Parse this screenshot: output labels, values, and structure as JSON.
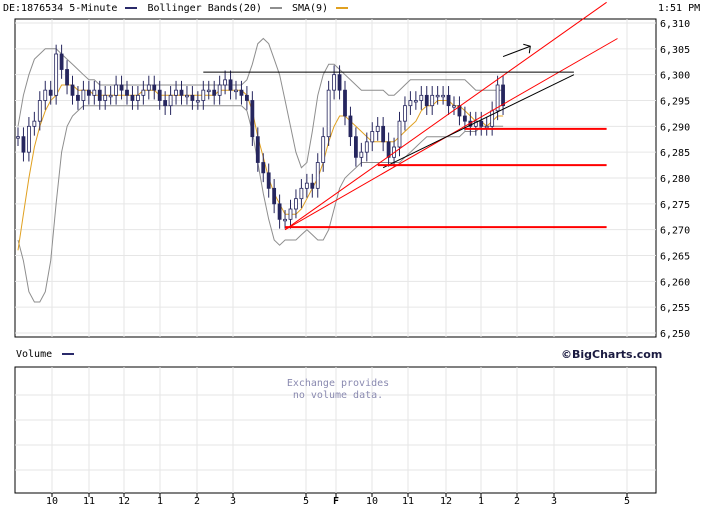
{
  "header": {
    "symbol": "DE:1876534",
    "interval": "5-Minute",
    "time": "1:51 PM",
    "legend": [
      {
        "label": "Bollinger Bands(20)",
        "color": "#8e8e8e",
        "icon": "gray-line-swatch"
      },
      {
        "label": "SMA(9)",
        "color": "#e0a020",
        "icon": "orange-line-swatch"
      }
    ],
    "symbol_swatch_color": "#2a2a6a"
  },
  "volume_panel": {
    "label": "Volume",
    "swatch_color": "#2a2a6a",
    "brand": "©BigCharts.com",
    "message_line1": "Exchange provides",
    "message_line2": "no volume data."
  },
  "colors": {
    "grid": "#e6e6e6",
    "price": "#26265e",
    "band": "#8e8e8e",
    "sma": "#e0a020",
    "support": "#ff0000",
    "resistance": "#000000",
    "message": "#8a8ab0"
  },
  "chart_data": {
    "type": "candlestick",
    "title": "DE:1876534 5-Minute",
    "ylim": [
      6250,
      6310
    ],
    "y_ticks": [
      "6,250",
      "6,255",
      "6,260",
      "6,265",
      "6,270",
      "6,275",
      "6,280",
      "6,285",
      "6,290",
      "6,295",
      "6,300",
      "6,305",
      "6,310"
    ],
    "x_ticks": [
      "10",
      "11",
      "12",
      "1",
      "2",
      "3",
      "5",
      "F",
      "10",
      "11",
      "12",
      "1",
      "2",
      "3",
      "5"
    ],
    "grid": true,
    "series": [
      {
        "name": "Price",
        "values": [
          6288,
          6285,
          6290,
          6291,
          6295,
          6297,
          6296,
          6304,
          6301,
          6298,
          6296,
          6295,
          6297,
          6296,
          6297,
          6295,
          6296,
          6296,
          6298,
          6297,
          6296,
          6295,
          6296,
          6297,
          6298,
          6297,
          6295,
          6294,
          6296,
          6297,
          6296,
          6296,
          6295,
          6295,
          6297,
          6297,
          6296,
          6298,
          6299,
          6297,
          6297,
          6296,
          6295,
          6288,
          6283,
          6281,
          6278,
          6275,
          6272,
          6272,
          6274,
          6276,
          6278,
          6279,
          6278,
          6283,
          6288,
          6297,
          6300,
          6297,
          6292,
          6288,
          6284,
          6285,
          6287,
          6289,
          6290,
          6287,
          6284,
          6286,
          6291,
          6294,
          6295,
          6295,
          6296,
          6294,
          6296,
          6296,
          6296,
          6294,
          6294,
          6292,
          6291,
          6290,
          6291,
          6290,
          6290,
          6293,
          6298,
          6294
        ]
      },
      {
        "name": "Bollinger Bands(20) upper",
        "values": [
          6290,
          6296,
          6300,
          6303,
          6304,
          6305,
          6305,
          6305,
          6304,
          6303,
          6302,
          6301,
          6300,
          6299,
          6299,
          6298,
          6298,
          6298,
          6298,
          6298,
          6298,
          6298,
          6298,
          6298,
          6298,
          6298,
          6298,
          6298,
          6298,
          6298,
          6298,
          6298,
          6298,
          6298,
          6298,
          6298,
          6298,
          6298,
          6298,
          6298,
          6298,
          6298,
          6299,
          6302,
          6306,
          6307,
          6306,
          6303,
          6300,
          6295,
          6290,
          6285,
          6282,
          6283,
          6289,
          6296,
          6300,
          6302,
          6302,
          6301,
          6300,
          6299,
          6298,
          6297,
          6297,
          6297,
          6297,
          6297,
          6296,
          6296,
          6297,
          6298,
          6299,
          6299,
          6299,
          6299,
          6299,
          6299,
          6299,
          6299,
          6299,
          6299,
          6299,
          6298,
          6297,
          6297,
          6297,
          6297,
          6297,
          6297
        ]
      },
      {
        "name": "Bollinger Bands(20) lower",
        "values": [
          6268,
          6264,
          6258,
          6256,
          6256,
          6258,
          6264,
          6275,
          6285,
          6290,
          6292,
          6293,
          6294,
          6294,
          6294,
          6294,
          6294,
          6294,
          6294,
          6294,
          6294,
          6294,
          6294,
          6294,
          6294,
          6294,
          6294,
          6294,
          6294,
          6294,
          6294,
          6294,
          6294,
          6294,
          6294,
          6294,
          6294,
          6294,
          6294,
          6294,
          6294,
          6294,
          6293,
          6289,
          6283,
          6277,
          6272,
          6268,
          6267,
          6268,
          6268,
          6268,
          6269,
          6270,
          6269,
          6268,
          6268,
          6270,
          6274,
          6278,
          6280,
          6281,
          6282,
          6283,
          6283,
          6283,
          6283,
          6283,
          6283,
          6283,
          6283,
          6284,
          6285,
          6286,
          6287,
          6288,
          6288,
          6288,
          6288,
          6288,
          6288,
          6288,
          6289,
          6289,
          6289,
          6290,
          6290,
          6290,
          6290,
          6290
        ]
      },
      {
        "name": "SMA(9)",
        "values": [
          6266,
          6273,
          6280,
          6286,
          6290,
          6293,
          6295,
          6296,
          6298,
          6298,
          6298,
          6297,
          6297,
          6297,
          6296,
          6296,
          6296,
          6296,
          6296,
          6296,
          6296,
          6296,
          6296,
          6297,
          6297,
          6297,
          6296,
          6296,
          6296,
          6296,
          6296,
          6296,
          6296,
          6296,
          6296,
          6296,
          6296,
          6297,
          6297,
          6297,
          6297,
          6297,
          6296,
          6293,
          6288,
          6284,
          6280,
          6277,
          6275,
          6273,
          6273,
          6273,
          6274,
          6276,
          6278,
          6280,
          6283,
          6287,
          6290,
          6292,
          6292,
          6291,
          6290,
          6289,
          6288,
          6287,
          6287,
          6287,
          6287,
          6287,
          6288,
          6289,
          6290,
          6291,
          6293,
          6294,
          6294,
          6295,
          6295,
          6295,
          6294,
          6294,
          6293,
          6292,
          6291,
          6291,
          6290,
          6291,
          6292,
          6292
        ]
      }
    ],
    "annotations": {
      "red_horizontal": [
        {
          "value": 6289.5,
          "from_bar": 82,
          "to_bar": 108
        },
        {
          "value": 6282.5,
          "from_bar": 66,
          "to_bar": 108
        },
        {
          "value": 6270.5,
          "from_bar": 49,
          "to_bar": 108
        }
      ],
      "red_trend": [
        {
          "from": [
            49,
            6270
          ],
          "to": [
            108,
            6314
          ]
        },
        {
          "from": [
            49,
            6270
          ],
          "to": [
            110,
            6307
          ]
        }
      ],
      "black_trend": {
        "from": [
          67,
          6282
        ],
        "to": [
          102,
          6300
        ]
      },
      "black_horizontal": {
        "value": 6300.5,
        "from_bar": 34,
        "to_bar": 102
      },
      "arrow": {
        "from": [
          89,
          6303.5
        ],
        "to": [
          94,
          6305.5
        ]
      }
    }
  }
}
